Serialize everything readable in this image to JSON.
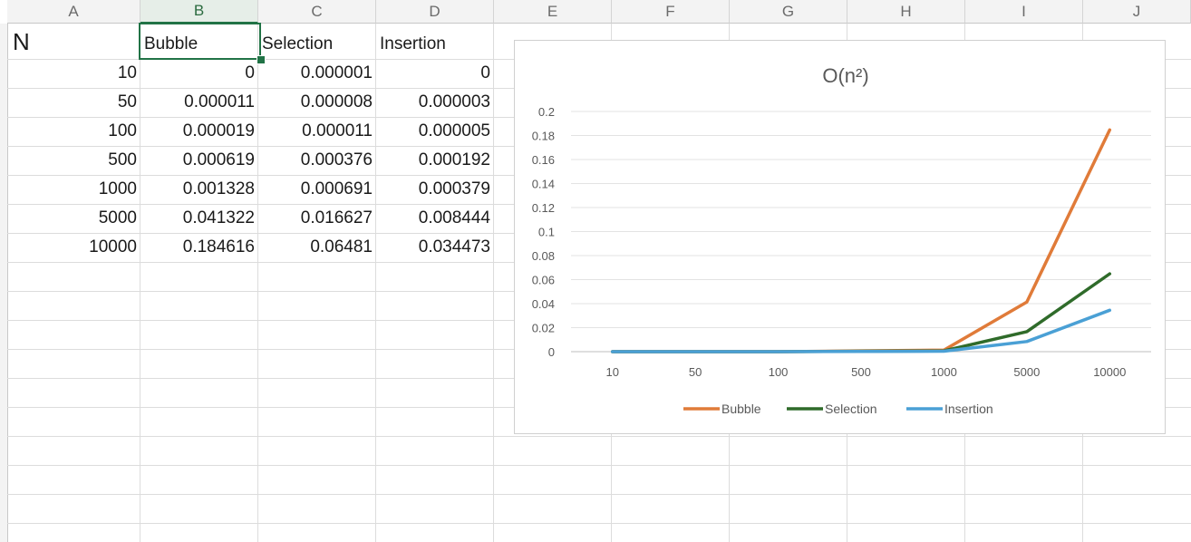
{
  "columns": [
    "A",
    "B",
    "C",
    "D",
    "E",
    "F",
    "G",
    "H",
    "I",
    "J"
  ],
  "selected_column": "B",
  "header_row": [
    "N",
    "Bubble",
    "Selection",
    "Insertion"
  ],
  "rows": [
    [
      "10",
      "0",
      "0.000001",
      "0"
    ],
    [
      "50",
      "0.000011",
      "0.000008",
      "0.000003"
    ],
    [
      "100",
      "0.000019",
      "0.000011",
      "0.000005"
    ],
    [
      "500",
      "0.000619",
      "0.000376",
      "0.000192"
    ],
    [
      "1000",
      "0.001328",
      "0.000691",
      "0.000379"
    ],
    [
      "5000",
      "0.041322",
      "0.016627",
      "0.008444"
    ],
    [
      "10000",
      "0.184616",
      "0.06481",
      "0.034473"
    ]
  ],
  "chart_data": {
    "type": "line",
    "title": "O(n²)",
    "categories": [
      "10",
      "50",
      "100",
      "500",
      "1000",
      "5000",
      "10000"
    ],
    "series": [
      {
        "name": "Bubble",
        "color": "#e07b39",
        "values": [
          0,
          1.1e-05,
          1.9e-05,
          0.000619,
          0.001328,
          0.041322,
          0.184616
        ]
      },
      {
        "name": "Selection",
        "color": "#2f6b2a",
        "values": [
          1e-06,
          8e-06,
          1.1e-05,
          0.000376,
          0.000691,
          0.016627,
          0.06481
        ]
      },
      {
        "name": "Insertion",
        "color": "#4aa0d5",
        "values": [
          0,
          3e-06,
          5e-06,
          0.000192,
          0.000379,
          0.008444,
          0.034473
        ]
      }
    ],
    "y_ticks": [
      "0",
      "0.02",
      "0.04",
      "0.06",
      "0.08",
      "0.1",
      "0.12",
      "0.14",
      "0.16",
      "0.18",
      "0.2"
    ],
    "ylim": [
      0,
      0.2
    ],
    "xlabel": "",
    "ylabel": "",
    "grid": true,
    "legend": "bottom"
  }
}
